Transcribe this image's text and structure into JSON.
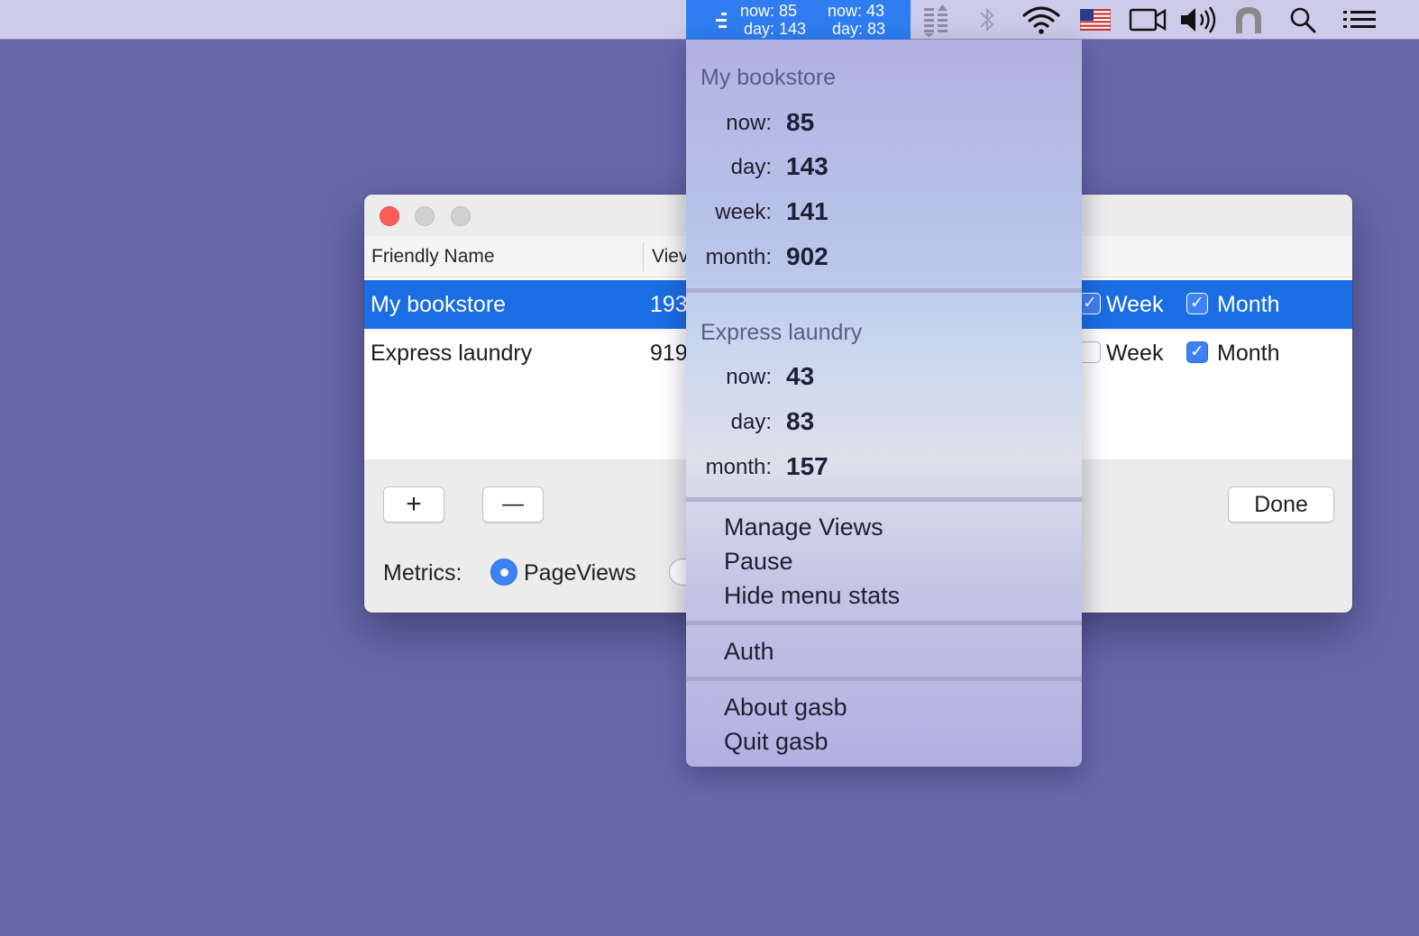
{
  "menubar": {
    "status": {
      "site1": {
        "now_text": "now: 85",
        "day_text": "day: 143"
      },
      "site2": {
        "now_text": "now: 43",
        "day_text": "day: 83"
      }
    },
    "icons": [
      "app-logo-icon",
      "stats-icon",
      "bluetooth-icon",
      "wifi-icon",
      "us-flag-icon",
      "camera-icon",
      "volume-icon",
      "airplay-icon",
      "search-icon",
      "list-icon"
    ]
  },
  "window": {
    "columns": {
      "friendly_name": "Friendly Name",
      "views": "Viev"
    },
    "rows": [
      {
        "name": "My bookstore",
        "views": "193",
        "week_label": "Week",
        "week_checked": true,
        "month_label": "Month",
        "month_checked": true,
        "selected": true
      },
      {
        "name": "Express laundry",
        "views": "919",
        "week_label": "Week",
        "week_checked": false,
        "month_label": "Month",
        "month_checked": true,
        "selected": false
      }
    ],
    "add_label": "+",
    "remove_label": "—",
    "done_label": "Done",
    "metrics_label": "Metrics:",
    "metric_option": "PageViews"
  },
  "menu": {
    "sites": [
      {
        "title": "My bookstore",
        "stats": [
          {
            "label": "now:",
            "value": "85"
          },
          {
            "label": "day:",
            "value": "143"
          },
          {
            "label": "week:",
            "value": "141"
          },
          {
            "label": "month:",
            "value": "902"
          }
        ]
      },
      {
        "title": "Express laundry",
        "stats": [
          {
            "label": "now:",
            "value": "43"
          },
          {
            "label": "day:",
            "value": "83"
          },
          {
            "label": "month:",
            "value": "157"
          }
        ]
      }
    ],
    "manage_views": "Manage Views",
    "pause": "Pause",
    "hide_stats": "Hide menu stats",
    "auth": "Auth",
    "about": "About gasb",
    "quit": "Quit gasb"
  },
  "colors": {
    "desktop": "#6868ab",
    "menubar": "#cdcbe9",
    "accent": "#2f7df0",
    "selection": "#1b6de3"
  }
}
